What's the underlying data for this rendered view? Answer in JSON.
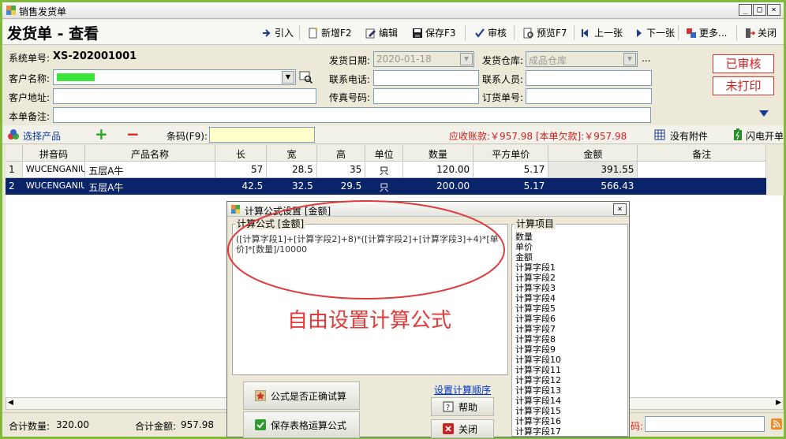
{
  "window": {
    "title": "销售发货单",
    "controls": [
      "_",
      "□",
      "×"
    ]
  },
  "toolbar": {
    "page_title": "发货单 - 查看",
    "buttons": [
      {
        "label": "引入",
        "icon": "import-arrow-icon"
      },
      {
        "label": "新增F2",
        "icon": "new-doc-icon"
      },
      {
        "label": "编辑",
        "icon": "edit-icon"
      },
      {
        "label": "保存F3",
        "icon": "save-icon"
      },
      {
        "label": "审核",
        "icon": "check-icon"
      },
      {
        "label": "预览F7",
        "icon": "preview-icon"
      },
      {
        "label": "上一张",
        "icon": "prev-icon"
      },
      {
        "label": "下一张",
        "icon": "next-icon"
      },
      {
        "label": "更多...",
        "icon": "more-icon"
      },
      {
        "label": "关闭",
        "icon": "exit-icon"
      }
    ]
  },
  "form": {
    "order_no_label": "系统单号:",
    "order_no": "XS-202001001",
    "customer_label": "客户名称:",
    "customer_value": "",
    "address_label": "客户地址:",
    "remark_label": "本单备注:",
    "ship_date_label": "发货日期:",
    "ship_date": "2020-01-18",
    "phone_label": "联系电话:",
    "fax_label": "传真号码:",
    "warehouse_label": "发货仓库:",
    "warehouse": "成品仓库",
    "contact_label": "联系人员:",
    "order_ref_label": "订货单号:",
    "ellipsis": "...",
    "audited": "已审核",
    "unprinted": "未打印"
  },
  "product_bar": {
    "select_label": "选择产品",
    "plus": "+",
    "minus": "−",
    "barcode_label": "条码(F9):",
    "receivable": "应收账款:￥957.98 [本单欠款]:￥957.98",
    "no_attachment": "没有附件",
    "flash": "闪电开单"
  },
  "grid": {
    "headers": [
      "",
      "拼音码",
      "产品名称",
      "长",
      "宽",
      "高",
      "单位",
      "数量",
      "平方单价",
      "金额",
      "备注"
    ],
    "rows": [
      [
        "1",
        "WUCENGANIU",
        "五层A牛",
        "57",
        "28.5",
        "35",
        "只",
        "120.00",
        "5.17",
        "391.55",
        ""
      ],
      [
        "2",
        "WUCENGANIU",
        "五层A牛",
        "42.5",
        "32.5",
        "29.5",
        "只",
        "200.00",
        "5.17",
        "566.43",
        ""
      ]
    ],
    "selected_row": 1
  },
  "status": {
    "total_qty_label": "合计数量:",
    "total_qty": "320.00",
    "total_amount_label": "合计金额:",
    "total_amount": "957.98",
    "partial_label": "码:"
  },
  "dialog": {
    "title": "计算公式设置 [金额]",
    "formula_group_label": "计算公式 [金额]",
    "formula": "([计算字段1]+[计算字段2]+8)*([计算字段2]+[计算字段3]+4)*[单价]*[数量]/10000",
    "annotation": "自由设置计算公式",
    "items_label": "计算项目",
    "items": [
      "数量",
      "单价",
      "金额",
      "计算字段1",
      "计算字段2",
      "计算字段3",
      "计算字段4",
      "计算字段5",
      "计算字段6",
      "计算字段7",
      "计算字段8",
      "计算字段9",
      "计算字段10",
      "计算字段11",
      "计算字段12",
      "计算字段13",
      "计算字段14",
      "计算字段15",
      "计算字段16",
      "计算字段17"
    ],
    "test_button": "公式是否正确试算",
    "save_button": "保存表格运算公式",
    "order_link": "设置计算顺序",
    "help_button": "帮助",
    "close_button": "关闭"
  },
  "colors": {
    "selection": "#0a246a",
    "alert_red": "#cc2222",
    "ellipse": "#e23a3a",
    "link_blue": "#0033cc",
    "frame_green": "#7fba3b"
  }
}
